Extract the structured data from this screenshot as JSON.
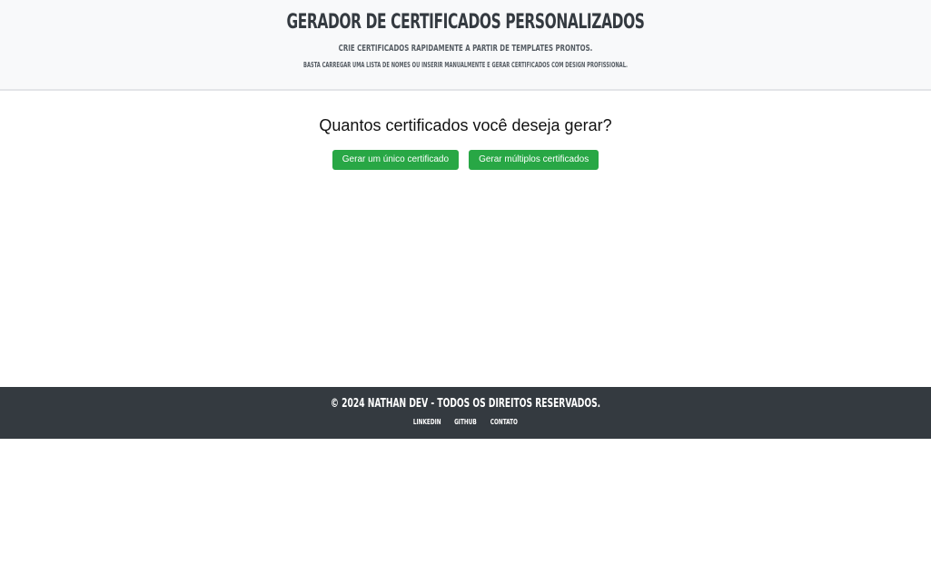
{
  "header": {
    "title": "Gerador de Certificados Personalizados",
    "subtitle": "Crie certificados rapidamente a partir de templates prontos.",
    "description": "Basta carregar uma lista de nomes ou inserir manualmente e gerar certificados com design profissional."
  },
  "main": {
    "question": "Quantos certificados você deseja gerar?",
    "single_button_label": "Gerar um único certificado",
    "multiple_button_label": "Gerar múltiplos certificados"
  },
  "footer": {
    "copyright": "© 2024 Nathan Dev - Todos os direitos reservados.",
    "links": [
      {
        "label": "LinkedIn"
      },
      {
        "label": "GitHub"
      },
      {
        "label": "Contato"
      }
    ]
  },
  "colors": {
    "header_bg": "#f8f9fa",
    "button_green": "#28a745",
    "footer_bg": "#343a40"
  }
}
